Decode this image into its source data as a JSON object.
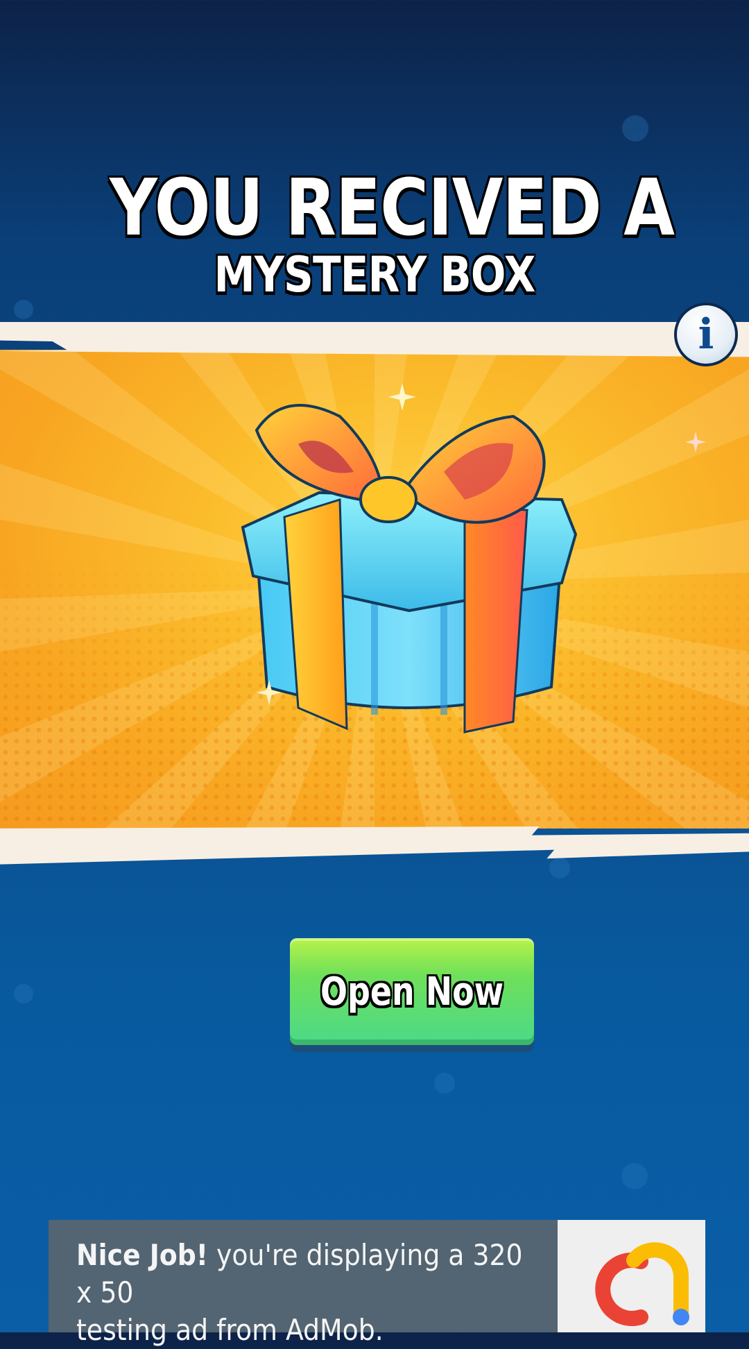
{
  "title": {
    "line1": "YOU RECIVED A",
    "line2": "MYSTERY BOX"
  },
  "banner": {
    "icon": "gift-box-icon"
  },
  "info_button": {
    "label": "i",
    "icon": "info-icon"
  },
  "open_button": {
    "label": "Open Now"
  },
  "ad": {
    "bold": "Nice Job!",
    "text1": " you're displaying a 320 x 50",
    "text2": "testing ad from AdMob.",
    "logo_icon": "admob-logo-icon"
  },
  "colors": {
    "background": "#0b4f8f",
    "banner": "#fbbd2c",
    "button": "#5fdb6a",
    "ad_background": "#536472"
  }
}
